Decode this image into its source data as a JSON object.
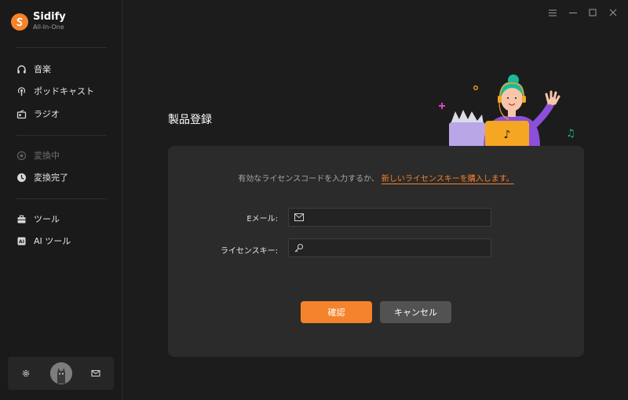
{
  "app": {
    "name": "Sidify",
    "subtitle": "All-In-One"
  },
  "sidebar": {
    "items": [
      {
        "label": "音楽",
        "icon": "headphones-icon"
      },
      {
        "label": "ポッドキャスト",
        "icon": "podcast-icon"
      },
      {
        "label": "ラジオ",
        "icon": "radio-icon"
      },
      {
        "label": "変換中",
        "icon": "converting-icon"
      },
      {
        "label": "変換完了",
        "icon": "clock-icon"
      },
      {
        "label": "ツール",
        "icon": "toolbox-icon"
      },
      {
        "label": "AI ツール",
        "icon": "ai-icon"
      }
    ]
  },
  "page": {
    "title": "製品登録"
  },
  "register": {
    "intro": "有効なライセンスコードを入力するか、",
    "buy_link": "新しいライセンスキーを購入します。",
    "email_label": "Eメール:",
    "key_label": "ライセンスキー:",
    "email_value": "",
    "key_value": "",
    "ok_label": "確認",
    "cancel_label": "キャンセル"
  },
  "colors": {
    "accent": "#f5832b",
    "background": "#1c1c1c",
    "card": "#2b2b2b",
    "illustration_purple": "#8b4fd9"
  }
}
